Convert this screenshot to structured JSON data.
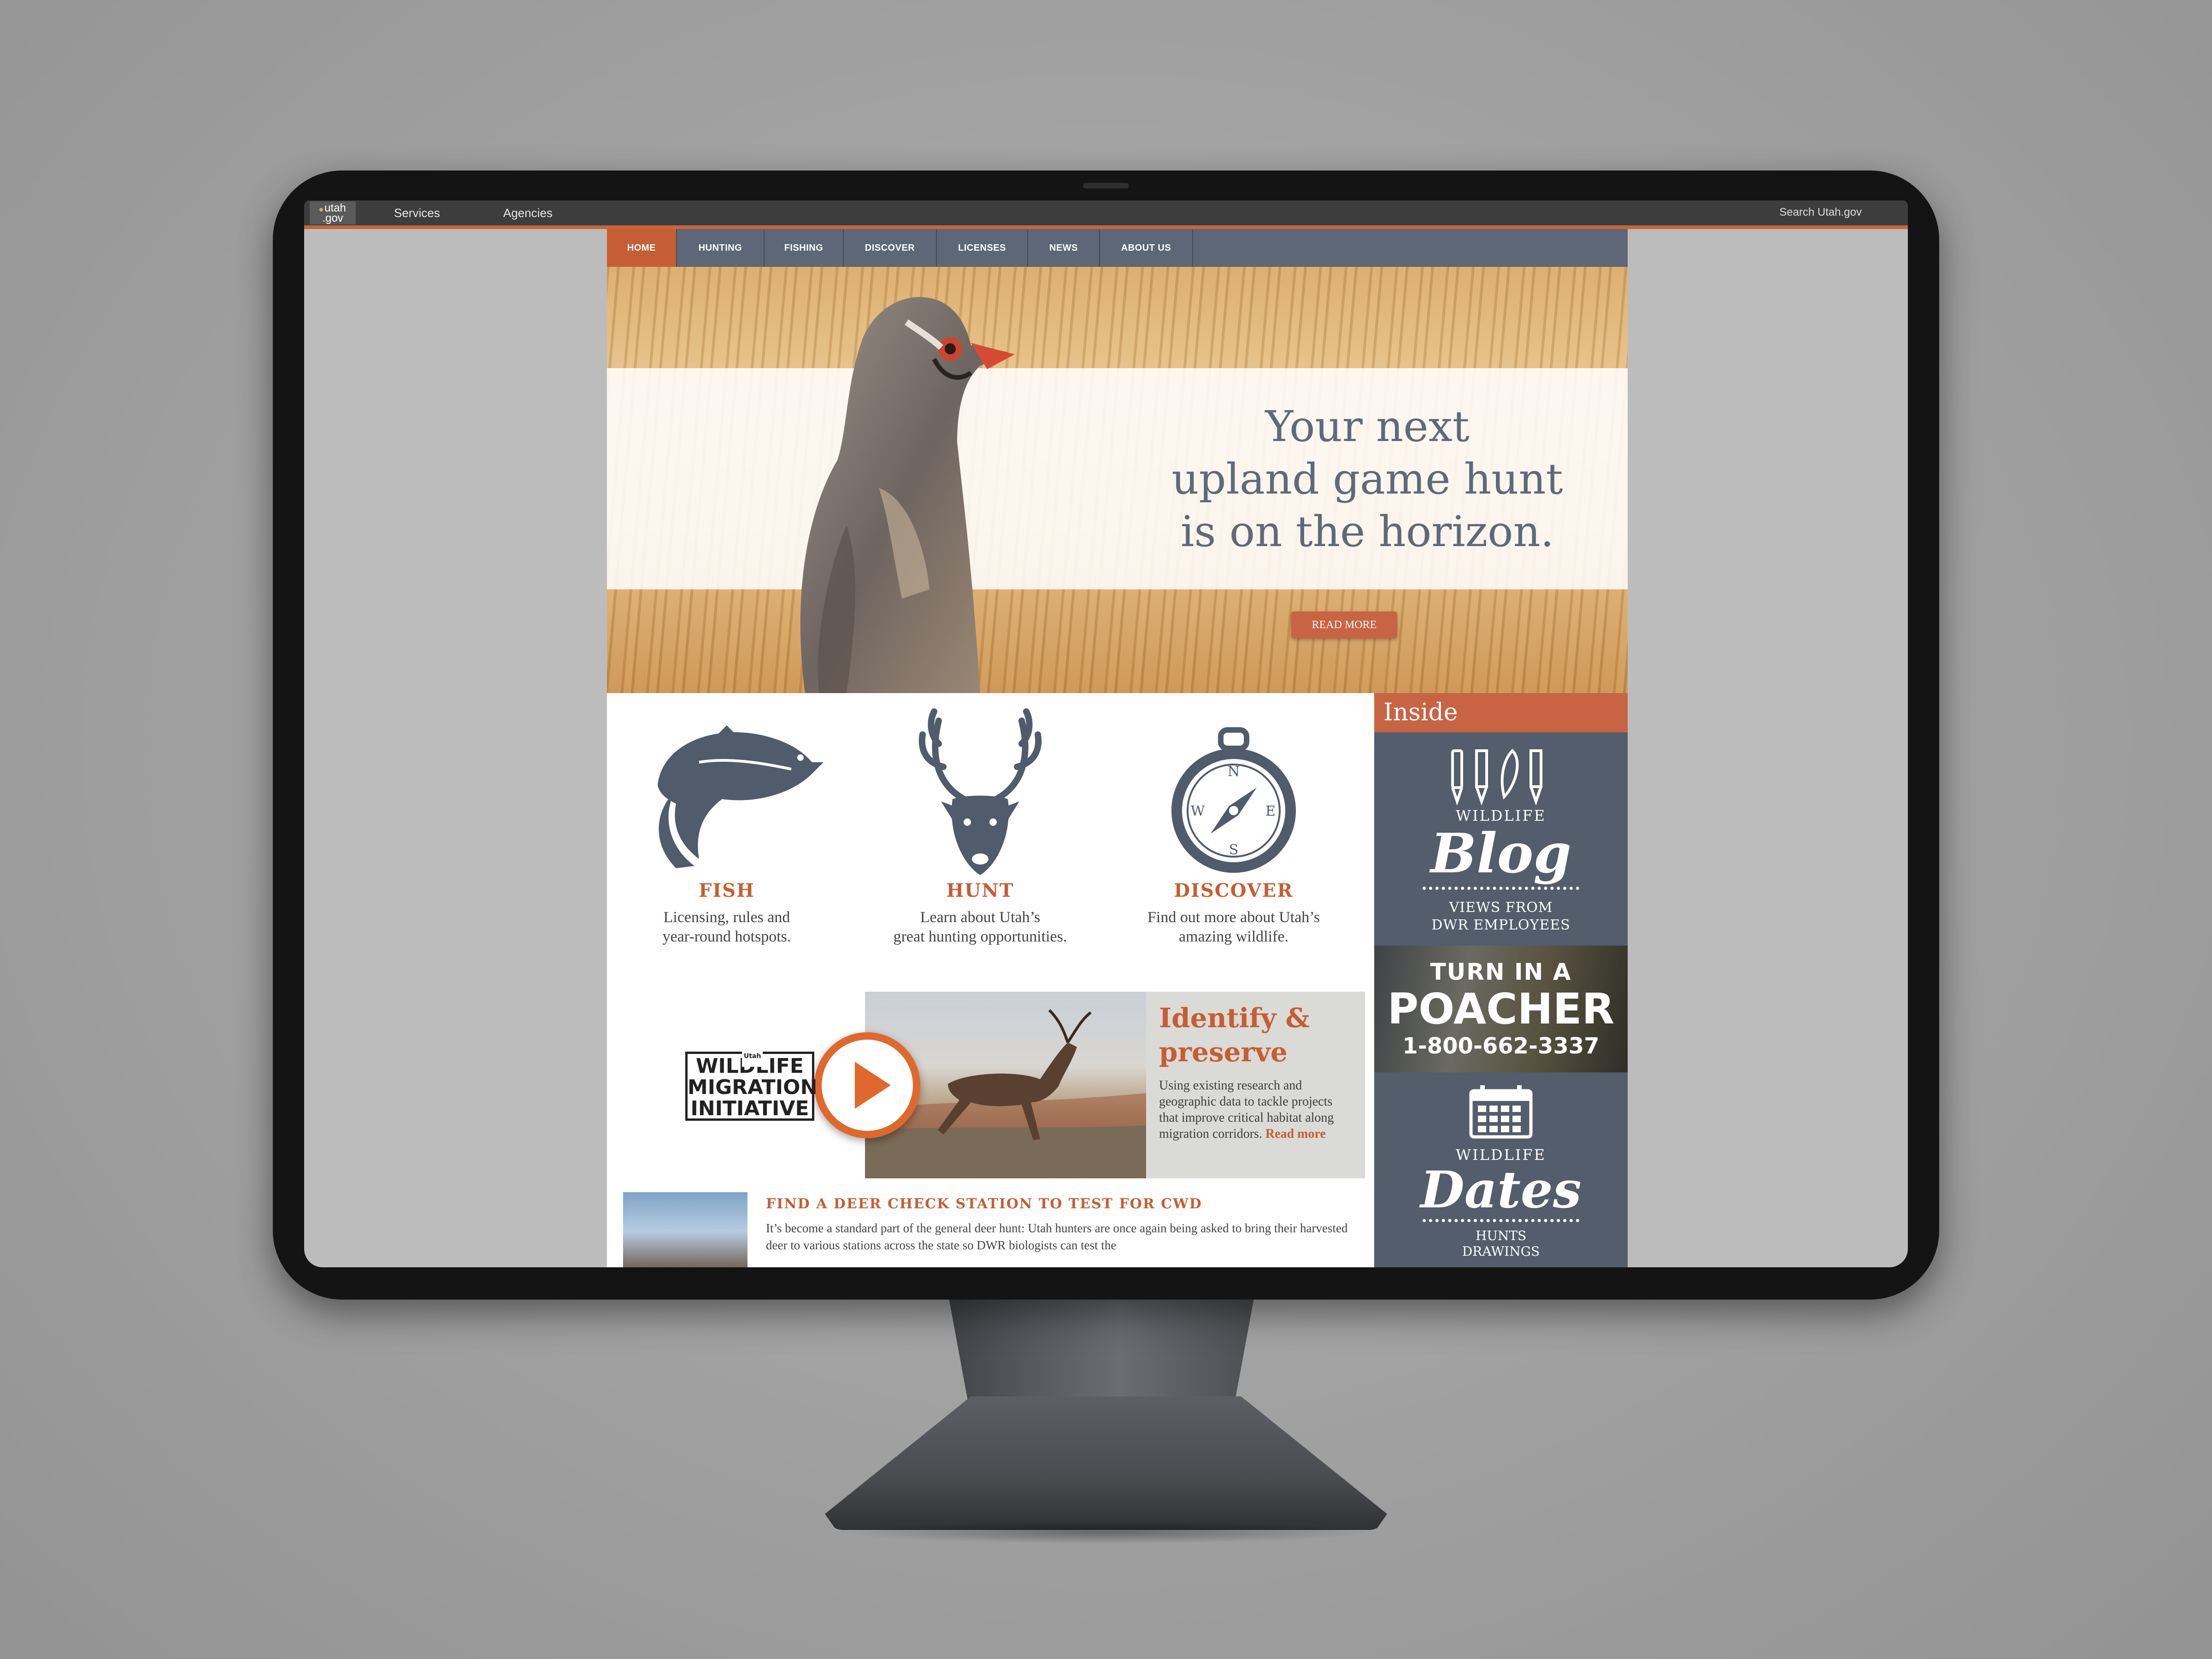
{
  "utah_bar": {
    "logo_line1": "utah",
    "logo_line2": ".gov",
    "services": "Services",
    "agencies": "Agencies",
    "search_placeholder": "Search Utah.gov"
  },
  "nav": {
    "items": [
      "HOME",
      "HUNTING",
      "FISHING",
      "DISCOVER",
      "LICENSES",
      "NEWS",
      "ABOUT US"
    ],
    "active": "HOME"
  },
  "hero": {
    "line1": "Your next",
    "line2": "upland game hunt",
    "line3": "is on the horizon.",
    "button": "READ MORE"
  },
  "features": [
    {
      "icon": "trout-icon",
      "title": "FISH",
      "line1": "Licensing, rules and",
      "line2": "year-round hotspots."
    },
    {
      "icon": "deer-head-icon",
      "title": "HUNT",
      "line1": "Learn about Utah’s",
      "line2": "great hunting opportunities."
    },
    {
      "icon": "compass-icon",
      "title": "DISCOVER",
      "line1": "Find out more about Utah’s",
      "line2": "amazing wildlife."
    }
  ],
  "migration": {
    "logo_small": "Utah",
    "logo_line1": "WILDLIFE",
    "logo_line2": "MIGRATION",
    "logo_line3": "INITIATIVE",
    "heading_line1": "Identify &",
    "heading_line2": "preserve",
    "body": "Using existing research and geographic data to tackle projects that improve critical habitat along migration corridors.",
    "link": "Read more"
  },
  "news": {
    "title": "FIND A DEER CHECK STATION TO TEST FOR CWD",
    "body": "It’s become a standard part of the general deer hunt: Utah hunters are once again being asked to bring their harvested deer to various stations across the state so DWR biologists can test the"
  },
  "sidebar": {
    "heading": "Inside",
    "blog": {
      "top": "WILDLIFE",
      "big": "Blog",
      "sub1": "VIEWS FROM",
      "sub2": "DWR EMPLOYEES"
    },
    "poacher": {
      "line1": "TURN IN A",
      "line2": "POACHER",
      "phone": "1-800-662-3337"
    },
    "dates": {
      "top": "WILDLIFE",
      "big": "Dates",
      "sub1": "HUNTS",
      "sub2": "DRAWINGS"
    }
  },
  "colors": {
    "accent": "#c55e34",
    "nav": "#5d6778",
    "sidebar": "#525c6a"
  }
}
